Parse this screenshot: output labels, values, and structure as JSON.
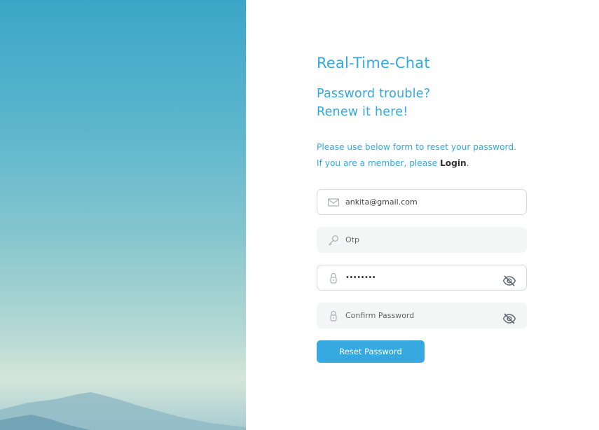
{
  "app": {
    "title": "Real-Time-Chat"
  },
  "heading": {
    "line1": "Password trouble?",
    "line2": "Renew it here!"
  },
  "info": {
    "line1": "Please use below form to reset your password.",
    "line2_prefix": "If you are a member, please ",
    "login_link": "Login",
    "line2_suffix": "."
  },
  "form": {
    "email": {
      "value": "ankita@gmail.com",
      "icon": "envelope-icon"
    },
    "otp": {
      "placeholder": "Otp",
      "value": "",
      "icon": "key-icon"
    },
    "password": {
      "value": "••••••••",
      "icon": "lock-icon",
      "toggle_icon": "eye-off-icon"
    },
    "confirm_password": {
      "placeholder": "Confirm Password",
      "value": "",
      "icon": "lock-icon",
      "toggle_icon": "eye-off-icon"
    },
    "submit_label": "Reset Password"
  },
  "colors": {
    "accent": "#33a9e0",
    "button": "#37a9e1",
    "field_bg": "#f4f5f5",
    "field_border": "#d6dadd"
  }
}
